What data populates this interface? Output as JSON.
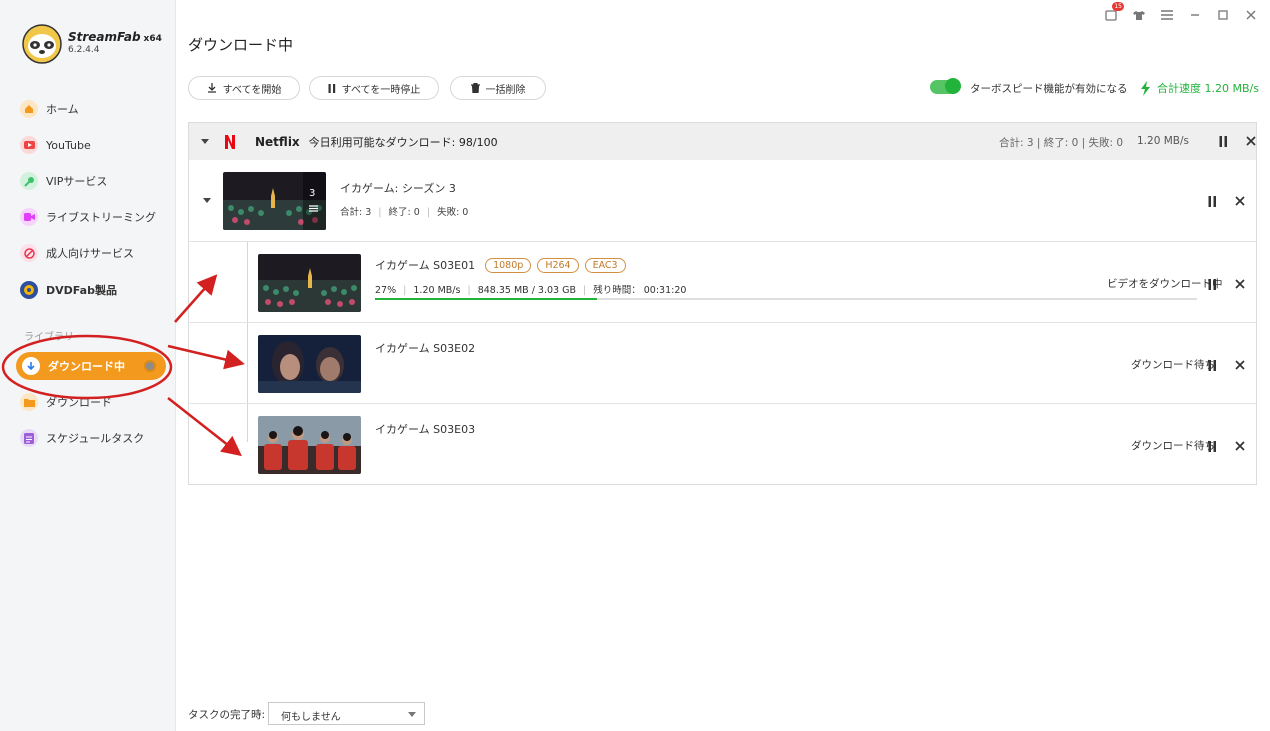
{
  "app": {
    "brand": "StreamFab",
    "arch": "x64",
    "version": "6.2.4.4"
  },
  "titlebar": {
    "notification_count": "15"
  },
  "sidebar": {
    "items": [
      {
        "label": "ホーム",
        "icon": "home-icon",
        "color": "#f39a1e"
      },
      {
        "label": "YouTube",
        "icon": "youtube-icon",
        "color": "#ef4444"
      },
      {
        "label": "VIPサービス",
        "icon": "key-icon",
        "color": "#3cc26b"
      },
      {
        "label": "ライブストリーミング",
        "icon": "video-camera-icon",
        "color": "#e040fb"
      },
      {
        "label": "成人向けサービス",
        "icon": "adult-icon",
        "color": "#f06292"
      },
      {
        "label": "DVDFab製品",
        "icon": "dvdfab-icon",
        "color": "#2e4f9e"
      }
    ],
    "section_label": "ライブラリ",
    "active_item": "ダウンロード中",
    "library_items": [
      {
        "label": "ダウンロード",
        "icon": "folder-icon",
        "color": "#f39a1e"
      },
      {
        "label": "スケジュールタスク",
        "icon": "schedule-icon",
        "color": "#9c5fd6"
      }
    ]
  },
  "main": {
    "title": "ダウンロード中",
    "toolbar": {
      "start_all": "すべてを開始",
      "pause_all": "すべてを一時停止",
      "delete_all": "一括削除"
    },
    "turbo_label": "ターボスピード機能が有効になる",
    "turbo_enabled": true,
    "total_speed": "合計速度 1.20 MB/s",
    "group": {
      "service": "Netflix",
      "quota": "今日利用可能なダウンロード: 98/100",
      "stats": "合計: 3 | 終了: 0 | 失敗: 0",
      "speed": "1.20 MB/s"
    },
    "season": {
      "title": "イカゲーム: シーズン 3",
      "count": "3",
      "stats": {
        "total": "合計: 3",
        "done": "終了: 0",
        "failed": "失敗: 0"
      }
    },
    "episodes": [
      {
        "title": "イカゲーム S03E01",
        "tags": [
          "1080p",
          "H264",
          "EAC3"
        ],
        "percent": "27%",
        "speed": "1.20 MB/s",
        "size": "848.35 MB / 3.03 GB",
        "remaining": "残り時間： 00:31:20",
        "progress": 0.27,
        "status": "ビデオをダウンロード中"
      },
      {
        "title": "イカゲーム S03E02",
        "status": "ダウンロード待ち"
      },
      {
        "title": "イカゲーム S03E03",
        "status": "ダウンロード待ち"
      }
    ]
  },
  "footer": {
    "label": "タスクの完了時:",
    "select_value": "何もしません"
  },
  "annotation": {
    "color": "#d32020"
  }
}
